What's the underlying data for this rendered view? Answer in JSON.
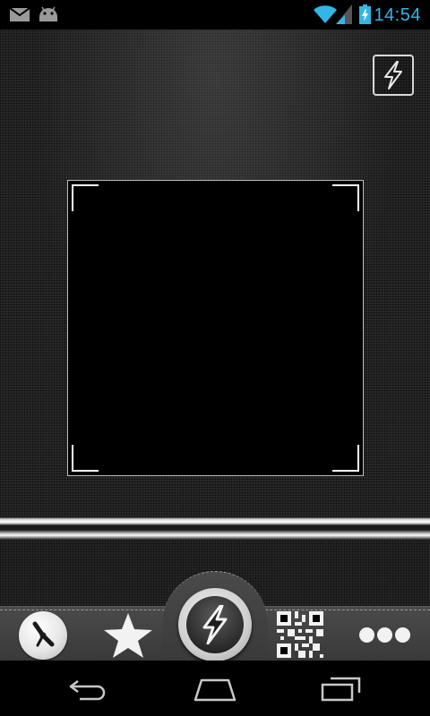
{
  "status_bar": {
    "time": "14:54",
    "icons": [
      "mail-icon",
      "android-icon",
      "wifi-icon",
      "signal-icon",
      "battery-charging-icon"
    ]
  },
  "scanner": {
    "flash_toggle_icon": "lightning-bolt-icon",
    "viewfinder_corners": [
      "top-left",
      "top-right",
      "bottom-left",
      "bottom-right"
    ]
  },
  "toolbar": {
    "buttons": [
      {
        "name": "history",
        "icon": "clock-icon"
      },
      {
        "name": "favorites",
        "icon": "star-icon"
      },
      {
        "name": "scan",
        "icon": "lightning-bolt-icon"
      },
      {
        "name": "qr-code",
        "icon": "qr-code-icon"
      },
      {
        "name": "more",
        "icon": "more-dots-icon"
      }
    ]
  },
  "nav_bar": {
    "buttons": [
      "back-icon",
      "home-icon",
      "recents-icon"
    ]
  },
  "colors": {
    "status_accent": "#33b5e5",
    "background": "#000000",
    "texture": "#2a2a2a",
    "toolbar": "#424242",
    "icon_light": "#f2f2f2"
  }
}
